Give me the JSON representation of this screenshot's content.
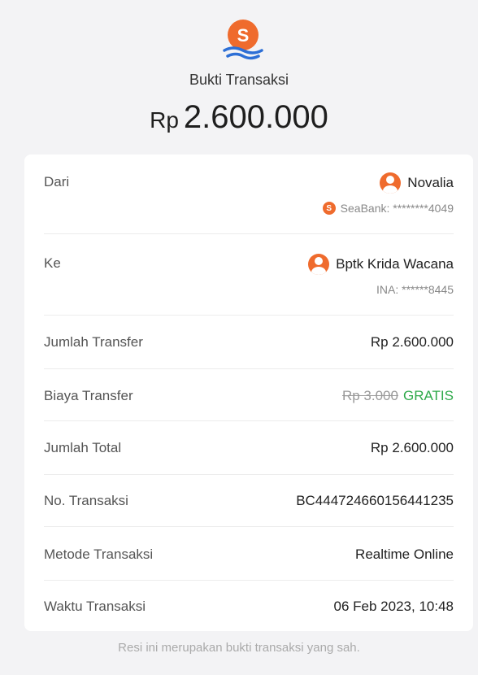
{
  "header": {
    "logo_letter": "S",
    "title": "Bukti Transaksi",
    "currency": "Rp",
    "amount": "2.600.000"
  },
  "rows": {
    "from": {
      "label": "Dari",
      "name": "Novalia",
      "account": "SeaBank: ********4049",
      "bank_letter": "S"
    },
    "to": {
      "label": "Ke",
      "name": "Bptk Krida Wacana",
      "account": "INA: ******8445"
    },
    "transfer_amount": {
      "label": "Jumlah Transfer",
      "value": "Rp 2.600.000"
    },
    "transfer_fee": {
      "label": "Biaya Transfer",
      "original": "Rp 3.000",
      "value": "GRATIS"
    },
    "total": {
      "label": "Jumlah Total",
      "value": "Rp 2.600.000"
    },
    "transaction_no": {
      "label": "No. Transaksi",
      "value": "BC444724660156441235"
    },
    "method": {
      "label": "Metode Transaksi",
      "value": "Realtime Online"
    },
    "time": {
      "label": "Waktu Transaksi",
      "value": "06 Feb 2023, 10:48"
    }
  },
  "footer": "Resi ini merupakan bukti transaksi yang sah.",
  "colors": {
    "brand": "#ef6b2d",
    "wave": "#2d6fd6",
    "free": "#2fa94a",
    "background": "#f3f3f5"
  }
}
